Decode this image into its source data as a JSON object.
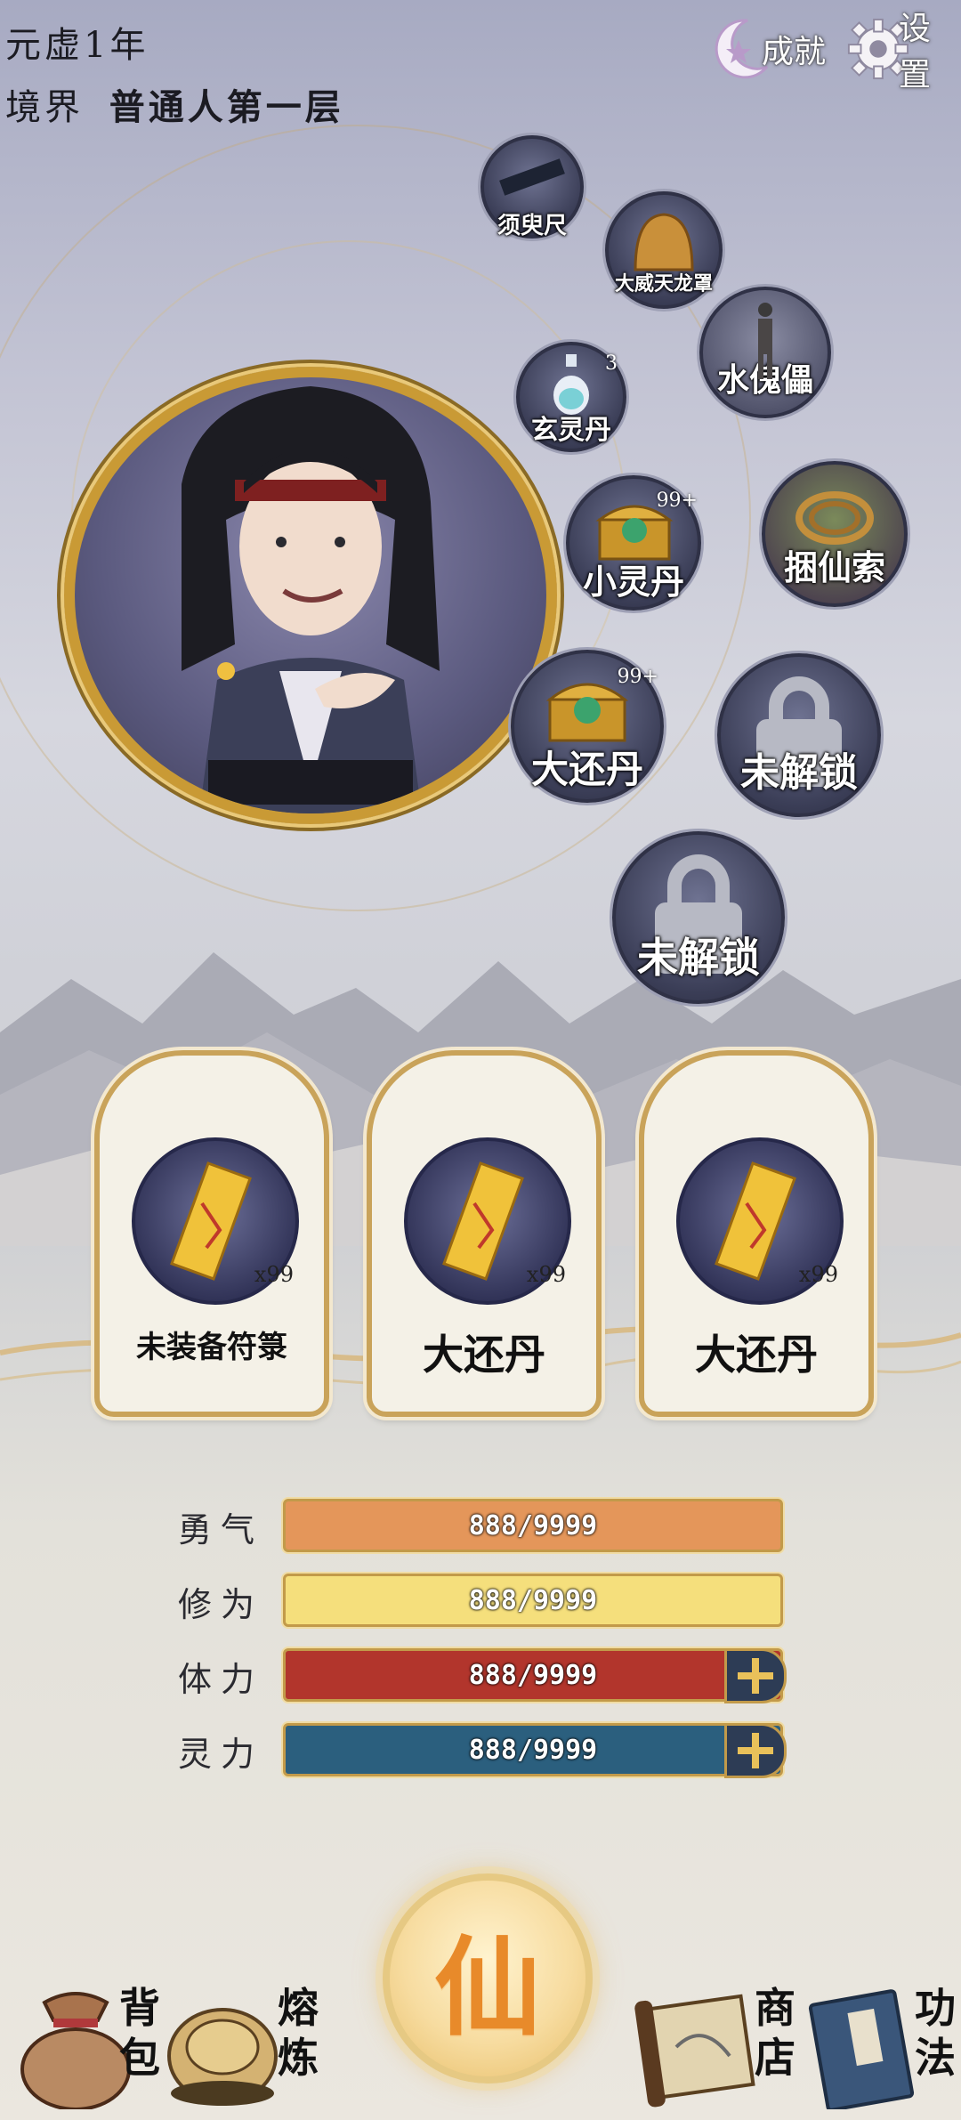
{
  "header": {
    "year": "元虚1年",
    "realm_label": "境界",
    "realm_value": "普通人第一层",
    "achievements_label": "成就",
    "settings_label": "设置"
  },
  "equipment": [
    {
      "name": "须臾尺",
      "count": ""
    },
    {
      "name": "大威天龙罩",
      "count": ""
    },
    {
      "name": "水傀儡",
      "count": ""
    },
    {
      "name": "玄灵丹",
      "count": "3"
    },
    {
      "name": "小灵丹",
      "count": "99+"
    },
    {
      "name": "捆仙索",
      "count": ""
    },
    {
      "name": "大还丹",
      "count": "99+"
    },
    {
      "name": "未解锁",
      "count": ""
    },
    {
      "name": "未解锁",
      "count": ""
    }
  ],
  "talisman_slots": [
    {
      "title": "未装备符箓",
      "count": "x99"
    },
    {
      "title": "大还丹",
      "count": "x99"
    },
    {
      "title": "大还丹",
      "count": "x99"
    }
  ],
  "stats": [
    {
      "label": "勇气",
      "value": "888/9999",
      "color": "#e4965a",
      "fill": 1.0
    },
    {
      "label": "修为",
      "value": "888/9999",
      "color": "#f5df7c",
      "fill": 1.0
    },
    {
      "label": "体力",
      "value": "888/9999",
      "color": "#b2352c",
      "fill": 1.0
    },
    {
      "label": "灵力",
      "value": "888/9999",
      "color": "#2b5f7e",
      "fill": 1.0
    }
  ],
  "nav": {
    "bag": "背包",
    "smelt": "熔炼",
    "center": "仙",
    "shop": "商店",
    "skills": "功法"
  }
}
